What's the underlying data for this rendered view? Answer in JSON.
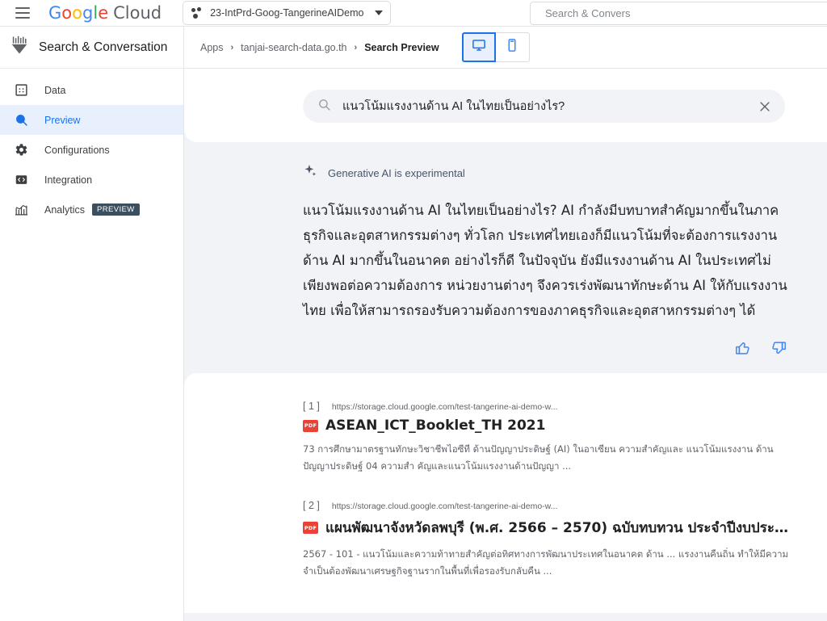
{
  "topbar": {
    "menu_icon": "hamburger-icon",
    "logo_text": "Google Cloud",
    "logo_word1": "Google",
    "logo_word2": "Cloud",
    "project": {
      "icon": "project-dots-icon",
      "name": "23-IntPrd-Goog-TangerineAIDemo",
      "caret": "chevron-down-icon"
    },
    "search": {
      "placeholder": "Search & Convers"
    }
  },
  "sidebar": {
    "product_icon": "search-conversation-icon",
    "product_title": "Search & Conversation",
    "items": [
      {
        "label": "Data",
        "icon": "data-grid-icon",
        "active": false,
        "badge": ""
      },
      {
        "label": "Preview",
        "icon": "search-icon",
        "active": true,
        "badge": ""
      },
      {
        "label": "Configurations",
        "icon": "gear-icon",
        "active": false,
        "badge": ""
      },
      {
        "label": "Integration",
        "icon": "code-brackets-icon",
        "active": false,
        "badge": ""
      },
      {
        "label": "Analytics",
        "icon": "analytics-chart-icon",
        "active": false,
        "badge": "PREVIEW"
      }
    ]
  },
  "breadcrumb": {
    "items": [
      "Apps",
      "tanjai-search-data.go.th",
      "Search Preview"
    ],
    "separator": "›",
    "view_toggle": {
      "desktop_icon": "desktop-monitor-icon",
      "mobile_icon": "mobile-phone-icon",
      "selected": "desktop"
    }
  },
  "search": {
    "icon": "search-icon",
    "query": "แนวโน้มแรงงานด้าน AI ในไทยเป็นอย่างไร?",
    "clear_icon": "close-icon"
  },
  "answer": {
    "sparkle_icon": "sparkle-icon",
    "disclaimer": "Generative AI is experimental",
    "text": "แนวโน้มแรงงานด้าน AI ในไทยเป็นอย่างไร? AI กำลังมีบทบาทสำคัญมากขึ้นในภาคธุรกิจและอุตสาหกรรมต่างๆ ทั่วโลก ประเทศไทยเองก็มีแนวโน้มที่จะต้องการแรงงานด้าน AI มากขึ้นในอนาคต อย่างไรก็ดี ในปัจจุบัน ยังมีแรงงานด้าน AI ในประเทศไม่เพียงพอต่อความต้องการ หน่วยงานต่างๆ จึงควรเร่งพัฒนาทักษะด้าน AI ให้กับแรงงานไทย เพื่อให้สามารถรองรับความต้องการของภาคธุรกิจและอุตสาหกรรมต่างๆ ได้",
    "thumbs_up_icon": "thumbs-up-icon",
    "thumbs_down_icon": "thumbs-down-icon"
  },
  "results": [
    {
      "index": "[ 1 ]",
      "url": "https://storage.cloud.google.com/test-tangerine-ai-demo-w...",
      "file_type": "PDF",
      "title": "ASEAN_ICT_Booklet_TH 2021",
      "snippet": "73 การศึกษามาตรฐานทักษะวิชาชีพไอซีที ด้านปัญญาประดิษฐ์ (AI) ในอาเซียน ความสำคัญและ แนวโน้มแรงงาน ด้านปัญญาประดิษฐ์ 04 ความสำ คัญและแนวโน้มแรงงานด้านปัญญา ..."
    },
    {
      "index": "[ 2 ]",
      "url": "https://storage.cloud.google.com/test-tangerine-ai-demo-w...",
      "file_type": "PDF",
      "title": "แผนพัฒนาจังหวัดลพบุรี (พ.ศ. 2566 – 2570) ฉบับทบทวน ประจำปีงบประมา...",
      "snippet": "2567 - 101 - แนวโน้มและความท้าทายสำคัญต่อทิศทางการพัฒนาประเทศในอนาคต ด้าน ... แรงงานคืนถิ่น ทำให้มีความจำเป็นต้องพัฒนาเศรษฐกิจฐานรากในพื้นที่เพื่อรองรับกลับคืน ..."
    }
  ],
  "colors": {
    "accent_blue": "#1a73e8",
    "active_bg": "#e8f0fe",
    "page_bg": "#f1f3f6",
    "pdf_red": "#ea4335",
    "badge_slate": "#3c4f5e",
    "text_primary": "#202124",
    "text_secondary": "#5f6368"
  }
}
